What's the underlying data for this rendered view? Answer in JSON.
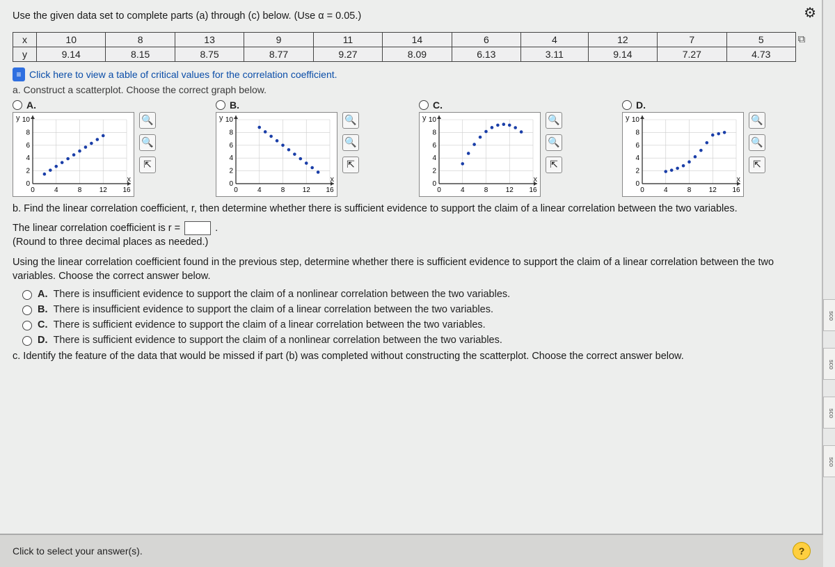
{
  "question_text": "Use the given data set to complete parts (a) through (c) below. (Use α = 0.05.)",
  "table": {
    "row_headers": [
      "x",
      "y"
    ],
    "x": [
      "10",
      "8",
      "13",
      "9",
      "11",
      "14",
      "6",
      "4",
      "12",
      "7",
      "5"
    ],
    "y": [
      "9.14",
      "8.15",
      "8.75",
      "8.77",
      "9.27",
      "8.09",
      "6.13",
      "3.11",
      "9.14",
      "7.27",
      "4.73"
    ]
  },
  "critical_link": "Click here to view a table of critical values for the correlation coefficient.",
  "part_a": "a. Construct a scatterplot. Choose the correct graph below.",
  "options": {
    "A": "A.",
    "B": "B.",
    "C": "C.",
    "D": "D."
  },
  "axis": {
    "y_label": "y",
    "x_label": "x",
    "ticks_x": [
      "0",
      "4",
      "8",
      "12",
      "16"
    ],
    "ticks_y": [
      "0",
      "2",
      "4",
      "6",
      "8",
      "10"
    ]
  },
  "part_b_intro": "b. Find the linear correlation coefficient, r, then determine whether there is sufficient evidence to support the claim of a linear correlation between the two variables.",
  "r_sentence_pre": "The linear correlation coefficient is r = ",
  "r_sentence_post": ".",
  "round_note": "(Round to three decimal places as needed.)",
  "evidence_prompt": "Using the linear correlation coefficient found in the previous step, determine whether there is sufficient evidence to support the claim of a linear correlation between the two variables. Choose the correct answer below.",
  "mc": {
    "A": "There is insufficient evidence to support the claim of a nonlinear correlation between the two variables.",
    "B": "There is insufficient evidence to support the claim of a linear correlation between the two variables.",
    "C": "There is sufficient evidence to support the claim of a linear correlation between the two variables.",
    "D": "There is sufficient evidence to support the claim of a nonlinear correlation between the two variables."
  },
  "part_c": "c. Identify the feature of the data that would be missed if part (b) was completed without constructing the scatterplot. Choose the correct answer below.",
  "footer": "Click to select your answer(s).",
  "side_labels": [
    "sco",
    "sco",
    "sco",
    "sco"
  ],
  "chart_data": [
    {
      "type": "scatter",
      "option": "A",
      "xlim": [
        0,
        16
      ],
      "ylim": [
        0,
        10
      ],
      "points": [
        [
          2,
          1.5
        ],
        [
          3,
          2.1
        ],
        [
          4,
          2.7
        ],
        [
          5,
          3.3
        ],
        [
          6,
          3.9
        ],
        [
          7,
          4.5
        ],
        [
          8,
          5.1
        ],
        [
          9,
          5.7
        ],
        [
          10,
          6.3
        ],
        [
          11,
          6.9
        ],
        [
          12,
          7.5
        ]
      ]
    },
    {
      "type": "scatter",
      "option": "B",
      "xlim": [
        0,
        16
      ],
      "ylim": [
        0,
        10
      ],
      "points": [
        [
          4,
          8.8
        ],
        [
          5,
          8.1
        ],
        [
          6,
          7.4
        ],
        [
          7,
          6.7
        ],
        [
          8,
          6.0
        ],
        [
          9,
          5.3
        ],
        [
          10,
          4.6
        ],
        [
          11,
          3.9
        ],
        [
          12,
          3.2
        ],
        [
          13,
          2.5
        ],
        [
          14,
          1.8
        ]
      ]
    },
    {
      "type": "scatter",
      "option": "C",
      "xlim": [
        0,
        16
      ],
      "ylim": [
        0,
        10
      ],
      "points": [
        [
          4,
          3.11
        ],
        [
          5,
          4.73
        ],
        [
          6,
          6.13
        ],
        [
          7,
          7.27
        ],
        [
          8,
          8.15
        ],
        [
          9,
          8.77
        ],
        [
          10,
          9.14
        ],
        [
          11,
          9.27
        ],
        [
          12,
          9.14
        ],
        [
          13,
          8.75
        ],
        [
          14,
          8.09
        ]
      ]
    },
    {
      "type": "scatter",
      "option": "D",
      "xlim": [
        0,
        16
      ],
      "ylim": [
        0,
        10
      ],
      "points": [
        [
          4,
          1.9
        ],
        [
          5,
          2.1
        ],
        [
          6,
          2.4
        ],
        [
          7,
          2.8
        ],
        [
          8,
          3.4
        ],
        [
          9,
          4.2
        ],
        [
          10,
          5.2
        ],
        [
          11,
          6.4
        ],
        [
          12,
          7.6
        ],
        [
          13,
          7.8
        ],
        [
          14,
          8.0
        ]
      ]
    }
  ]
}
